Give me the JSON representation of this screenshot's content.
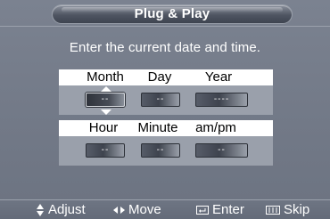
{
  "menu": {
    "title": "Plug & Play",
    "instruction": "Enter the current date and time."
  },
  "date": {
    "labels": [
      "Month",
      "Day",
      "Year"
    ],
    "values": [
      "--",
      "--",
      "----"
    ],
    "selected_index": 0
  },
  "time": {
    "labels": [
      "Hour",
      "Minute",
      "am/pm"
    ],
    "values": [
      "--",
      "--",
      "--"
    ]
  },
  "footer": {
    "hints": [
      {
        "icon": "up-down-arrows-icon",
        "label": "Adjust"
      },
      {
        "icon": "left-right-arrows-icon",
        "label": "Move"
      },
      {
        "icon": "enter-icon",
        "label": "Enter"
      },
      {
        "icon": "skip-icon",
        "label": "Skip"
      }
    ]
  },
  "colors": {
    "background": "#737a88",
    "band_label": "#ffffff",
    "band_field": "#9aa0ab",
    "text": "#ffffff"
  }
}
